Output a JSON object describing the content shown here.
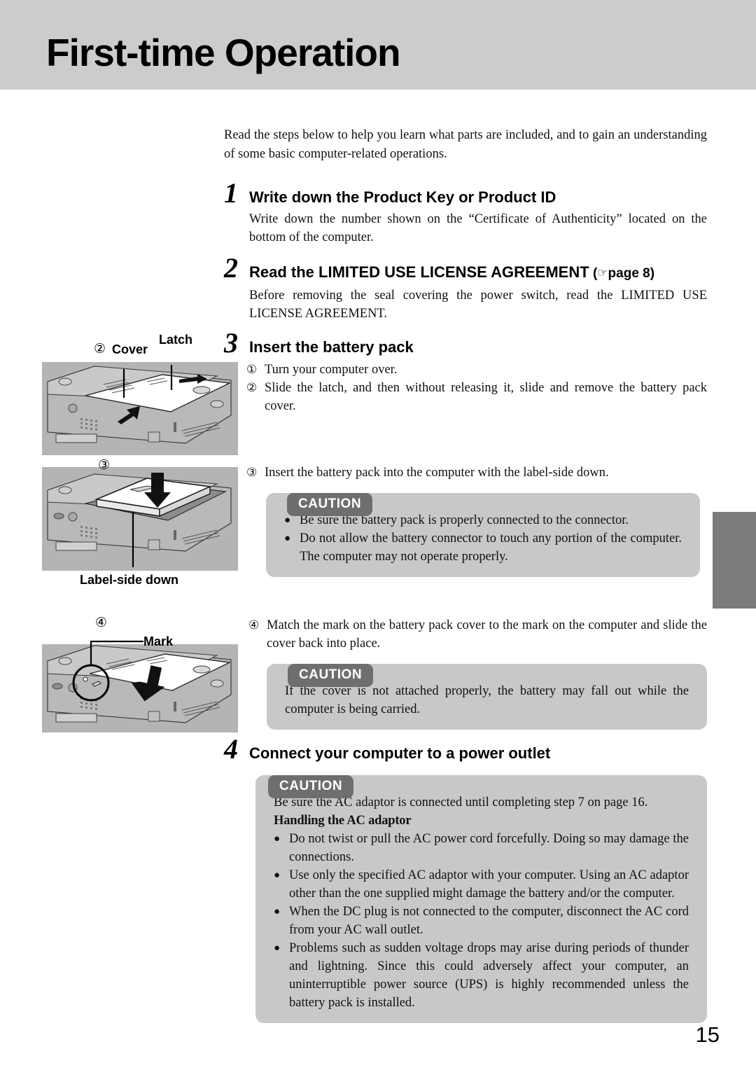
{
  "header": {
    "title": "First-time Operation"
  },
  "intro": "Read the steps below to help you learn what parts are included, and to gain an understanding of some basic computer-related operations.",
  "steps": [
    {
      "number": "1",
      "title": "Write down the Product Key or Product ID",
      "body": "Write down the number shown on the “Certificate of Authenticity” located on the bottom of the computer."
    },
    {
      "number": "2",
      "title": "Read the LIMITED USE LICENSE AGREEMENT",
      "ref_open": "(",
      "ref_icon": "☞",
      "ref_text": "page 8)",
      "body": "Before removing the seal covering the power switch, read the LIMITED USE LICENSE AGREEMENT."
    },
    {
      "number": "3",
      "title": "Insert the battery pack",
      "substeps": [
        {
          "mark": "①",
          "text": "Turn your computer over."
        },
        {
          "mark": "②",
          "text": "Slide the latch, and then without releasing it, slide and remove the battery pack cover."
        },
        {
          "mark": "③",
          "text": "Insert the battery pack into the computer with the label-side down."
        },
        {
          "mark": "④",
          "text": "Match the mark on the battery pack cover to the mark on the computer and slide the cover back into place."
        }
      ]
    },
    {
      "number": "4",
      "title": "Connect your computer to a power outlet"
    }
  ],
  "cautions": {
    "label": "CAUTION",
    "battery_connect": {
      "bullet_glyph": "●",
      "items": [
        "Be sure the battery pack is properly connected to the connector.",
        "Do not allow the battery connector to touch any portion of the computer.  The computer may not operate properly."
      ]
    },
    "cover_attach": {
      "text": "If the cover is not attached properly, the battery may fall out while the computer is being carried."
    },
    "ac_adaptor": {
      "intro": "Be sure the AC adaptor is connected until completing step 7 on page 16.",
      "subhead": "Handling the AC adaptor",
      "bullet_glyph": "●",
      "items": [
        "Do not twist or pull the AC power cord forcefully.  Doing so may damage the connections.",
        "Use only the specified AC adaptor with your computer.  Using an AC adaptor other than the one supplied might damage the battery and/or the computer.",
        "When the DC plug is not connected to the computer, disconnect the AC cord from your AC wall outlet.",
        "Problems such as sudden voltage drops may arise during periods of thunder and lightning.  Since this could adversely affect your computer, an uninterruptible power source (UPS) is highly recommended unless the battery pack is installed."
      ]
    }
  },
  "figures": [
    {
      "id": "fig-cover-latch",
      "circled_number": "②",
      "labels": [
        "Cover",
        "Latch"
      ]
    },
    {
      "id": "fig-battery-insert",
      "circled_number": "③",
      "labels": [
        "Label-side down"
      ]
    },
    {
      "id": "fig-mark-slide",
      "circled_number": "④",
      "labels": [
        "Mark"
      ]
    }
  ],
  "footer": {
    "page_number": "15"
  },
  "colors": {
    "header_bg": "#cccccc",
    "caution_label_bg": "#6e6e6e",
    "caution_body_bg": "#c8c8c8",
    "edge_tab": "#7b7b7b",
    "illustration_bg": "#b4b4b4"
  }
}
